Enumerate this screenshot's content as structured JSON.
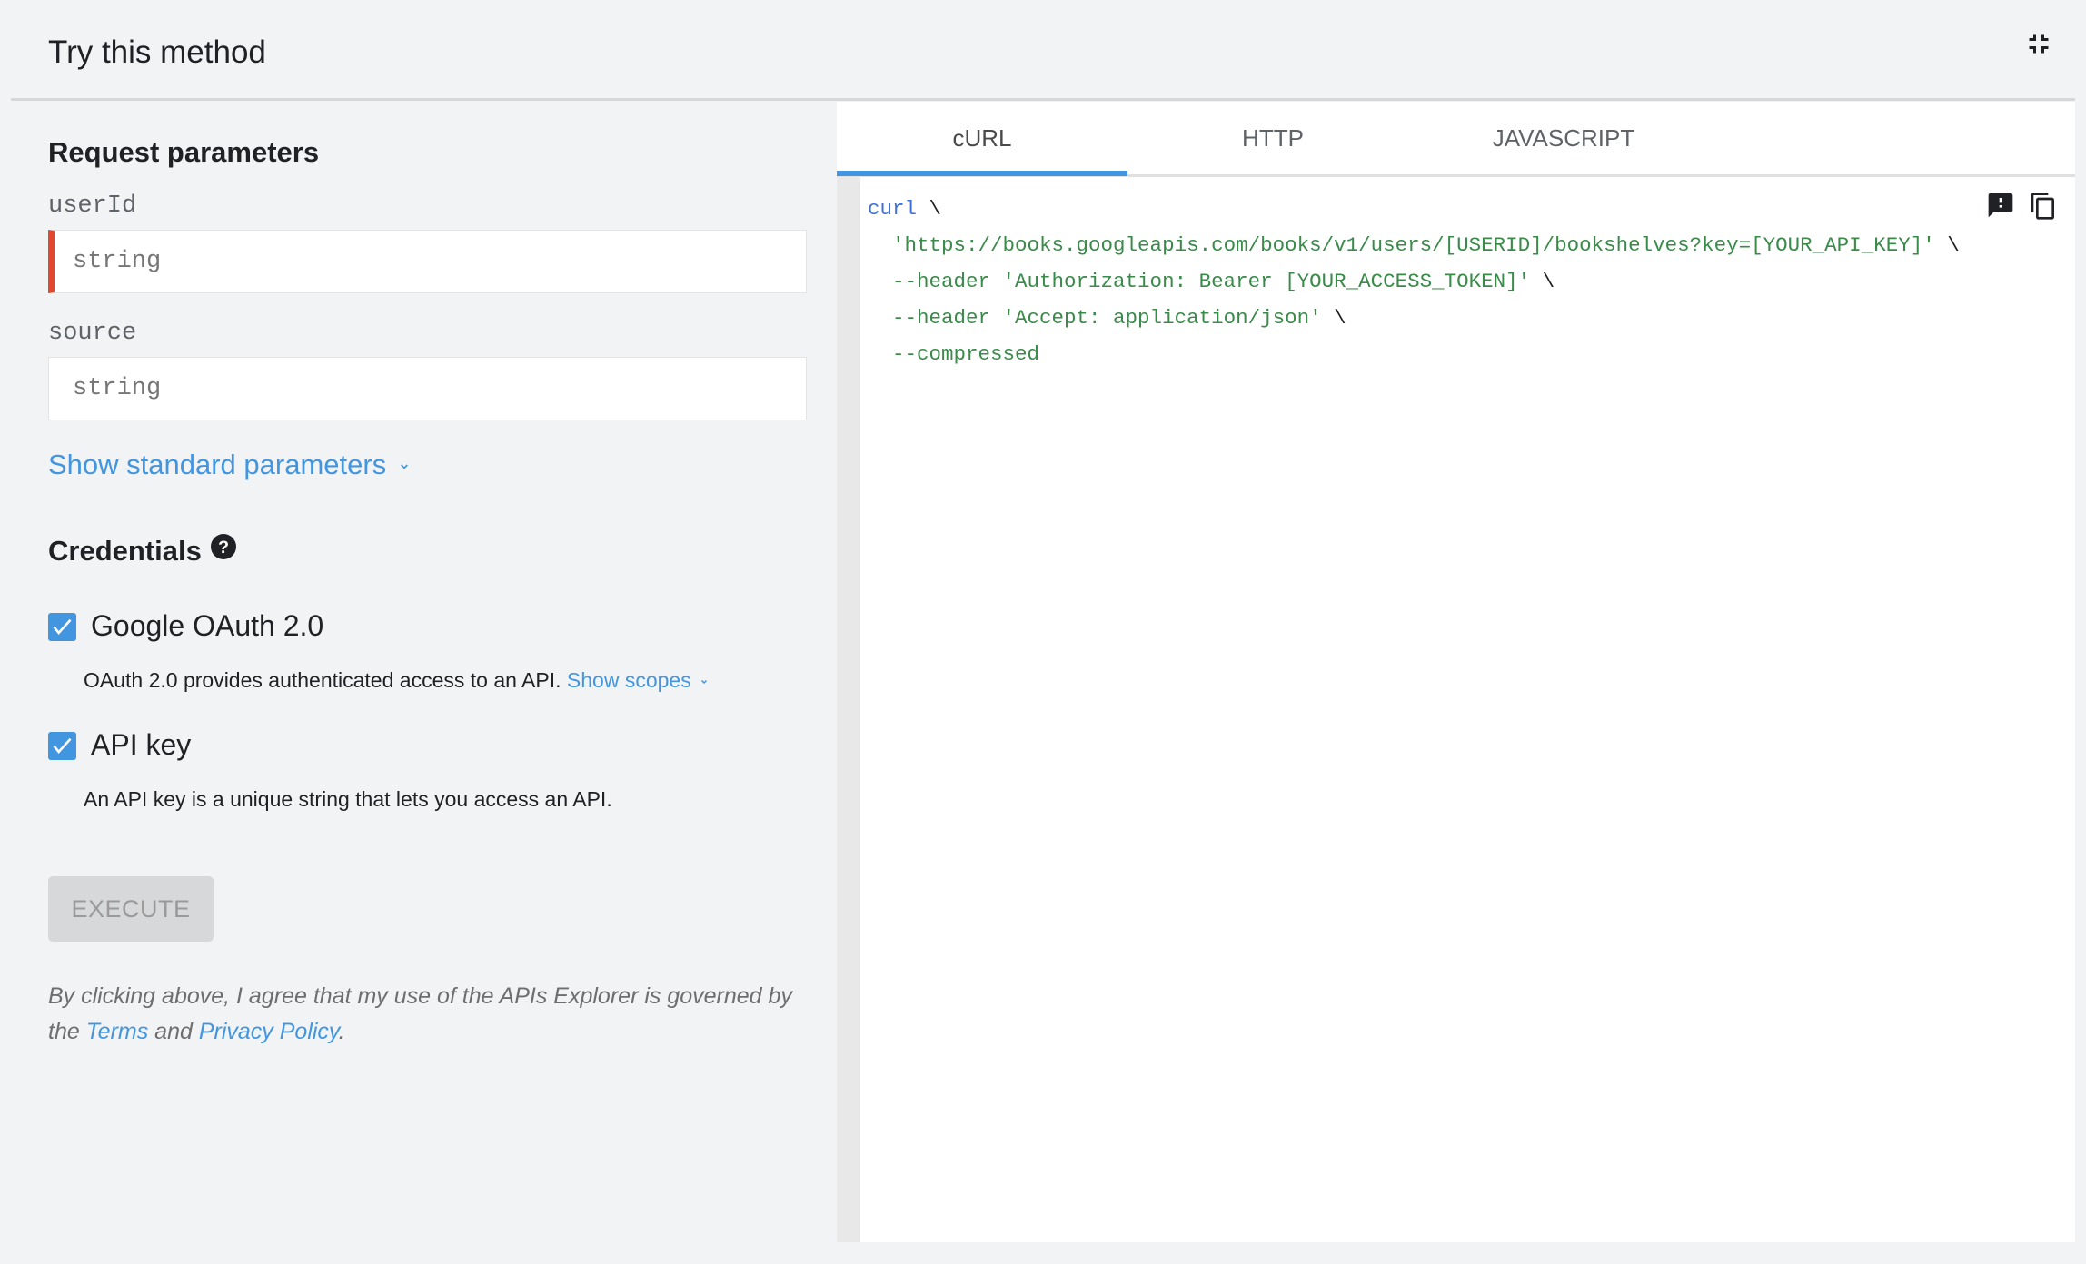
{
  "header": {
    "title": "Try this method",
    "collapse_icon": "fullscreen-exit-icon"
  },
  "params": {
    "heading": "Request parameters",
    "fields": [
      {
        "label": "userId",
        "placeholder": "string",
        "required": true
      },
      {
        "label": "source",
        "placeholder": "string",
        "required": false
      }
    ],
    "show_standard": "Show standard parameters"
  },
  "credentials": {
    "heading": "Credentials",
    "help_icon": "help-circle-icon",
    "items": [
      {
        "label": "Google OAuth 2.0",
        "checked": true,
        "desc": "OAuth 2.0 provides authenticated access to an API.",
        "link": "Show scopes"
      },
      {
        "label": "API key",
        "checked": true,
        "desc": "An API key is a unique string that lets you access an API."
      }
    ]
  },
  "execute_label": "EXECUTE",
  "disclaimer": {
    "pre": "By clicking above, I agree that my use of the APIs Explorer is governed by the ",
    "terms": "Terms",
    "and": " and ",
    "privacy": "Privacy Policy",
    "post": "."
  },
  "tabs": [
    {
      "label": "cURL",
      "active": true
    },
    {
      "label": "HTTP"
    },
    {
      "label": "JAVASCRIPT"
    }
  ],
  "code": {
    "cmd": "curl",
    "bs": " \\",
    "lines": [
      "'https://books.googleapis.com/books/v1/users/[USERID]/bookshelves?key=[YOUR_API_KEY]'",
      "--header 'Authorization: Bearer [YOUR_ACCESS_TOKEN]'",
      "--header 'Accept: application/json'",
      "--compressed"
    ],
    "icons": [
      "feedback-icon",
      "copy-icon"
    ]
  },
  "colors": {
    "accent": "#4296e0",
    "required": "#e0492f",
    "code_string": "#3a8a4a"
  }
}
